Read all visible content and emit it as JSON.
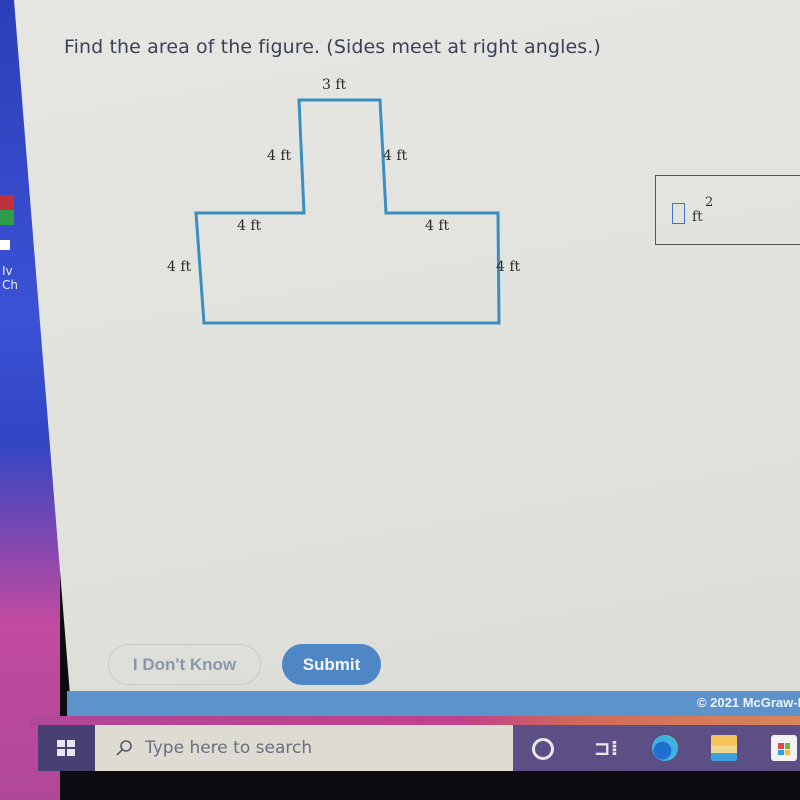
{
  "problem": {
    "question": "Find the area of the figure. (Sides meet at right angles.)",
    "figure": {
      "shape": "T-shaped polygon",
      "stroke_color": "#3a8fc0",
      "labels": {
        "top": "3 ft",
        "upper_left": "4 ft",
        "upper_right": "4 ft",
        "ledge_left": "4 ft",
        "ledge_right": "4 ft",
        "lower_left": "4 ft",
        "lower_right": "4 ft"
      }
    },
    "answer": {
      "value": "",
      "unit": "ft",
      "exponent": "2"
    }
  },
  "buttons": {
    "dont_know": "I Don't Know",
    "submit": "Submit"
  },
  "footer": {
    "copyright": "© 2021 McGraw-H"
  },
  "desktop": {
    "icon_label_line1": "Iv",
    "icon_label_line2": "Ch"
  },
  "taskbar": {
    "search_placeholder": "Type here to search",
    "apps": [
      "cortana",
      "task-view",
      "edge",
      "file-explorer",
      "microsoft-store"
    ]
  },
  "colors": {
    "submit_bg": "#4f86c6",
    "footer_bg": "#5d93cb",
    "taskbar_bg": "#5c4f86"
  }
}
